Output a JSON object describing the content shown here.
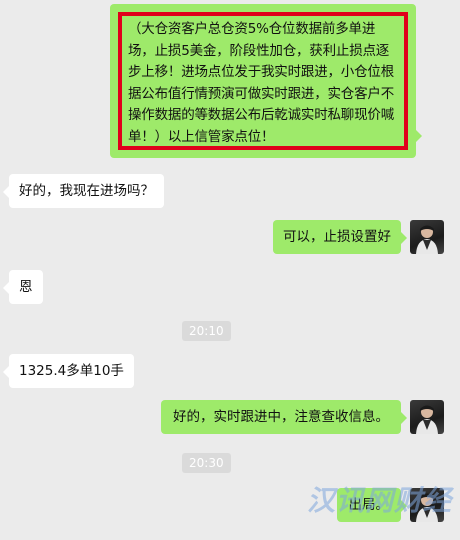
{
  "messages": [
    {
      "text": "（大仓资客户总仓资5%仓位数据前多单进场，止损5美金，阶段性加仓，获利止损点逐步上移！进场点位发于我实时跟进，小仓位根据公布值行情预演可做实时跟进，实仓客户不操作数据的等数据公布后乾诚实时私聊现价喊单！）以上信管家点位！"
    },
    {
      "text": "好的，我现在进场吗？"
    },
    {
      "text": "可以，止损设置好"
    },
    {
      "text": "恩"
    },
    {
      "text": "20:10"
    },
    {
      "text": "1325.4多单10手"
    },
    {
      "text": "好的，实时跟进中，注意查收信息。"
    },
    {
      "text": "20:30"
    },
    {
      "text": "出局。"
    }
  ],
  "watermark": {
    "text": "汉讯网财经"
  },
  "colors": {
    "background": "#ebebeb",
    "self_bubble": "#9eea6a",
    "other_bubble": "#ffffff",
    "highlight_border": "#e0001b"
  }
}
